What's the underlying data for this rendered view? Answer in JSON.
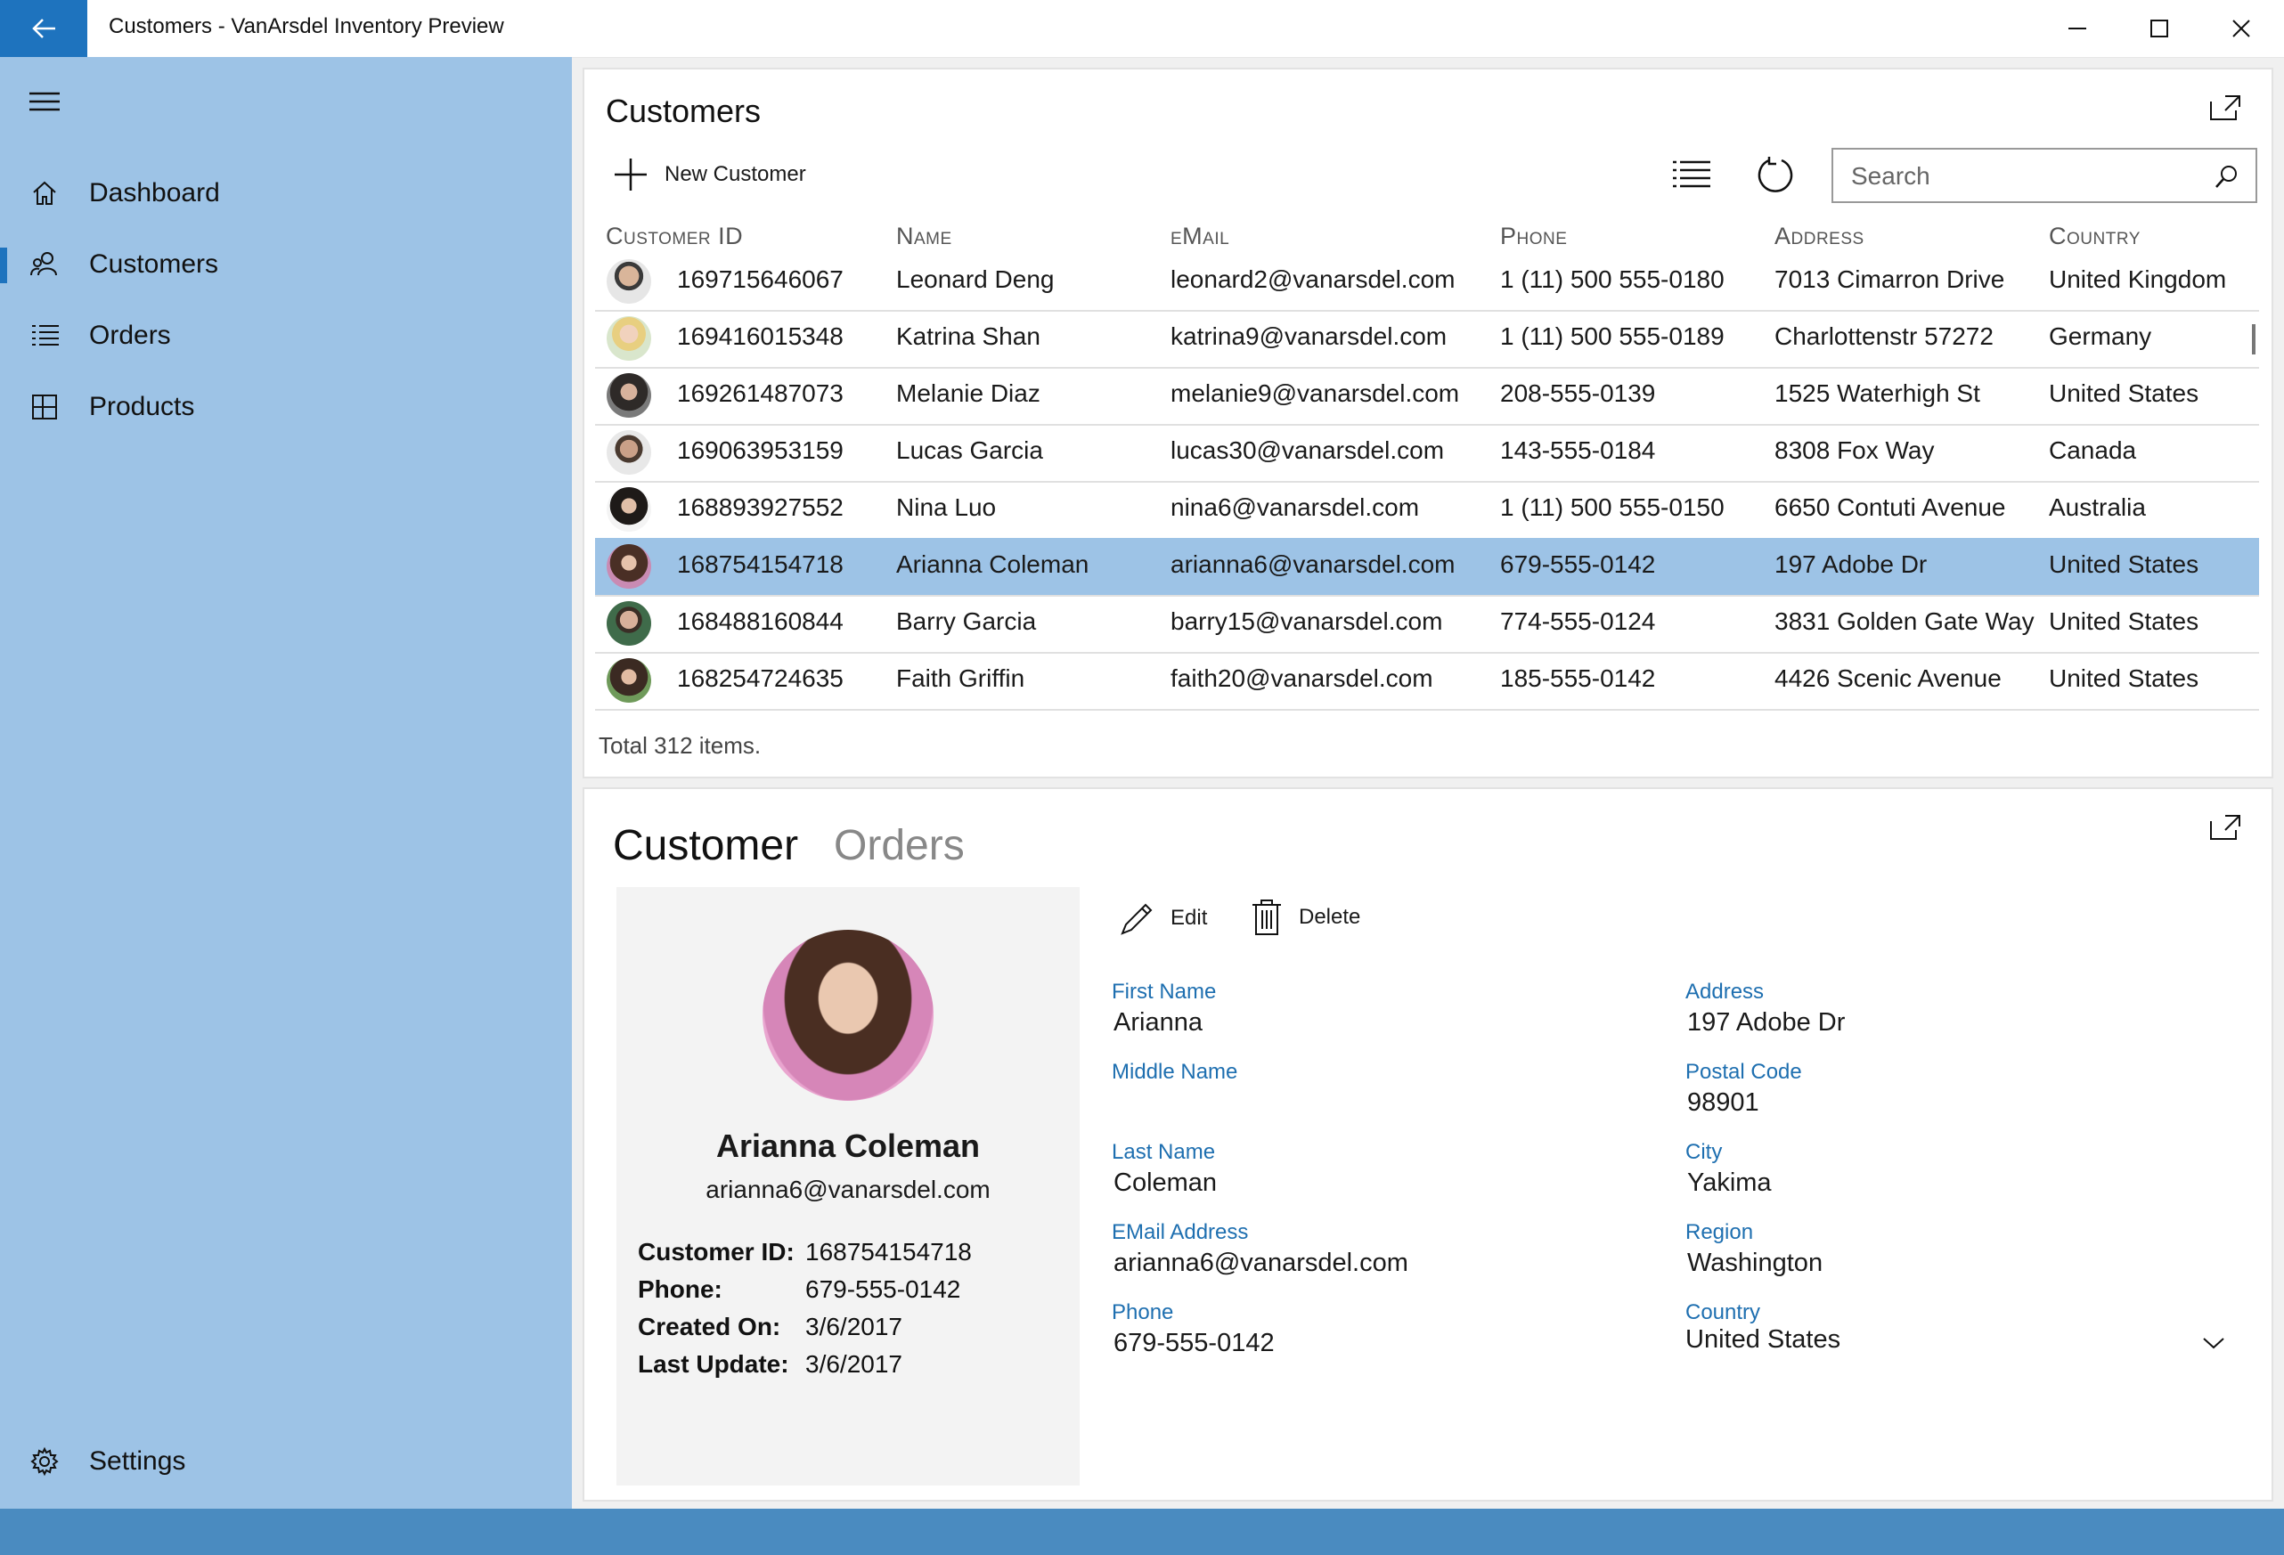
{
  "window": {
    "title": "Customers - VanArsdel Inventory Preview",
    "controls": [
      "minimize-icon",
      "maximize-icon",
      "close-icon"
    ]
  },
  "sidebar": {
    "menu_icon": "hamburger-icon",
    "items": [
      {
        "label": "Dashboard",
        "icon": "home-icon",
        "selected": false
      },
      {
        "label": "Customers",
        "icon": "people-icon",
        "selected": true
      },
      {
        "label": "Orders",
        "icon": "list-icon",
        "selected": false
      },
      {
        "label": "Products",
        "icon": "products-icon",
        "selected": false
      }
    ],
    "settings_label": "Settings"
  },
  "customers_panel": {
    "title": "Customers",
    "new_label": "New Customer",
    "search_placeholder": "Search",
    "columns": [
      "Customer ID",
      "Name",
      "eMail",
      "Phone",
      "Address",
      "Country"
    ],
    "rows": [
      {
        "id": "169715646067",
        "name": "Leonard Deng",
        "email": "leonard2@vanarsdel.com",
        "phone": "1 (11) 500 555-0180",
        "address": "7013 Cimarron Drive",
        "country": "United Kingdom",
        "selected": false
      },
      {
        "id": "169416015348",
        "name": "Katrina Shan",
        "email": "katrina9@vanarsdel.com",
        "phone": "1 (11) 500 555-0189",
        "address": "Charlottenstr 57272",
        "country": "Germany",
        "selected": false
      },
      {
        "id": "169261487073",
        "name": "Melanie Diaz",
        "email": "melanie9@vanarsdel.com",
        "phone": "208-555-0139",
        "address": "1525 Waterhigh St",
        "country": "United States",
        "selected": false
      },
      {
        "id": "169063953159",
        "name": "Lucas Garcia",
        "email": "lucas30@vanarsdel.com",
        "phone": "143-555-0184",
        "address": "8308 Fox Way",
        "country": "Canada",
        "selected": false
      },
      {
        "id": "168893927552",
        "name": "Nina Luo",
        "email": "nina6@vanarsdel.com",
        "phone": "1 (11) 500 555-0150",
        "address": "6650 Contuti Avenue",
        "country": "Australia",
        "selected": false
      },
      {
        "id": "168754154718",
        "name": "Arianna Coleman",
        "email": "arianna6@vanarsdel.com",
        "phone": "679-555-0142",
        "address": "197 Adobe Dr",
        "country": "United States",
        "selected": true
      },
      {
        "id": "168488160844",
        "name": "Barry Garcia",
        "email": "barry15@vanarsdel.com",
        "phone": "774-555-0124",
        "address": "3831 Golden Gate Way",
        "country": "United States",
        "selected": false
      },
      {
        "id": "168254724635",
        "name": "Faith Griffin",
        "email": "faith20@vanarsdel.com",
        "phone": "185-555-0142",
        "address": "4426 Scenic Avenue",
        "country": "United States",
        "selected": false
      }
    ],
    "total": "Total 312 items."
  },
  "details": {
    "tabs": [
      "Customer",
      "Orders"
    ],
    "active_tab": "Customer",
    "edit_label": "Edit",
    "delete_label": "Delete",
    "card": {
      "name": "Arianna Coleman",
      "email": "arianna6@vanarsdel.com",
      "meta": [
        {
          "label": "Customer ID:",
          "value": "168754154718"
        },
        {
          "label": "Phone:",
          "value": "679-555-0142"
        },
        {
          "label": "Created On:",
          "value": "3/6/2017"
        },
        {
          "label": "Last Update:",
          "value": "3/6/2017"
        }
      ]
    },
    "left_fields": [
      {
        "label": "First Name",
        "value": "Arianna"
      },
      {
        "label": "Middle Name",
        "value": ""
      },
      {
        "label": "Last Name",
        "value": "Coleman"
      },
      {
        "label": "EMail Address",
        "value": "arianna6@vanarsdel.com"
      },
      {
        "label": "Phone",
        "value": "679-555-0142"
      }
    ],
    "right_fields": [
      {
        "label": "Address",
        "value": "197 Adobe Dr"
      },
      {
        "label": "Postal Code",
        "value": "98901"
      },
      {
        "label": "City",
        "value": "Yakima"
      },
      {
        "label": "Region",
        "value": "Washington"
      },
      {
        "label": "Country",
        "value": "United States"
      }
    ]
  },
  "colors": {
    "accent": "#1e73be",
    "sidebar": "#9dc3e6",
    "selected_row": "#9dc3e6",
    "field_label": "#1e6fb0"
  }
}
